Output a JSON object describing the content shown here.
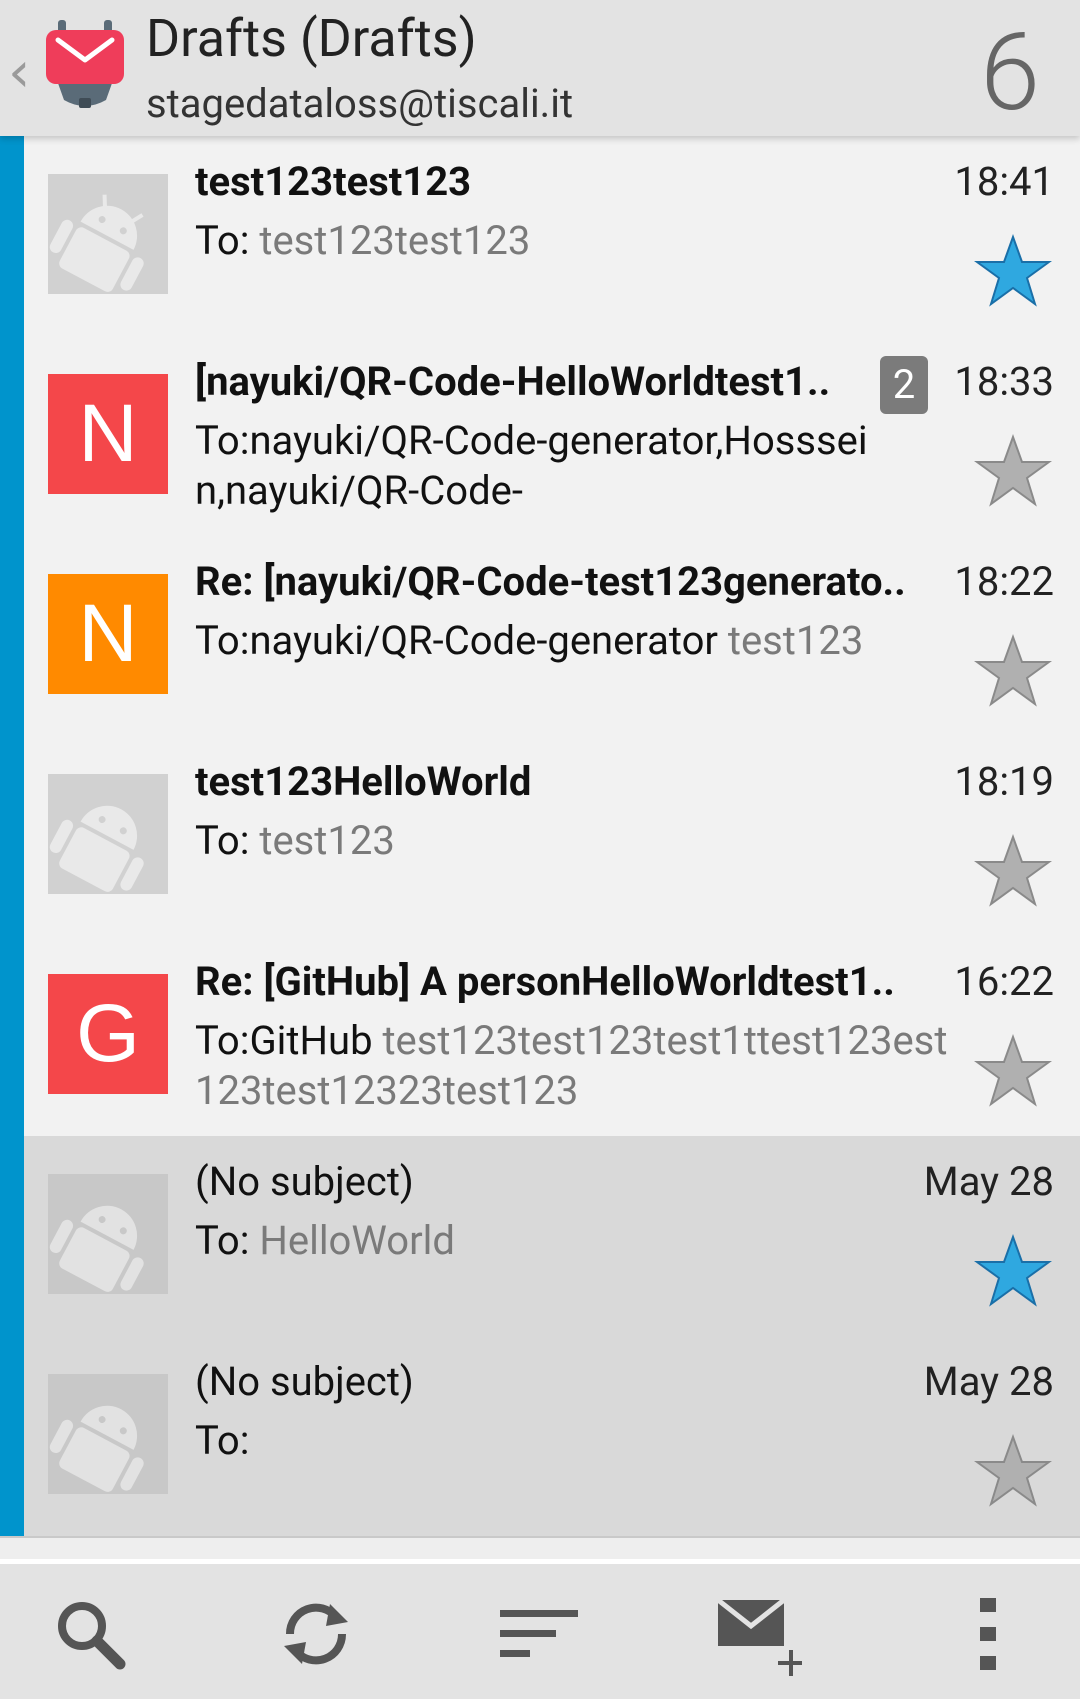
{
  "header": {
    "title": "Drafts (Drafts)",
    "account": "stagedataloss@tiscali.it",
    "count": "6",
    "logo_icon": "k9-mail-logo-icon",
    "back_icon": "chevron-left-icon"
  },
  "colors": {
    "accent": "#0094cc",
    "star_active": "#2fa8e0",
    "star_inactive": "#b0b0b0",
    "avatar_red": "#f4474a",
    "avatar_orange": "#ff8a00"
  },
  "messages": [
    {
      "subject": "test123test123",
      "to_label": "To: ",
      "to_name": "",
      "preview": "test123test123",
      "time": "18:41",
      "starred": true,
      "avatar": "placeholder"
    },
    {
      "subject": "[nayuki/QR-Code-HelloWorldtest1..",
      "to_label": "To:",
      "to_name": "nayuki/QR-Code-generator,Hosssein,nayuki/QR-Code-",
      "preview": "",
      "time": "18:33",
      "badge": "2",
      "starred": false,
      "avatar": "N"
    },
    {
      "subject": "Re: [nayuki/QR-Code-test123generato..",
      "to_label": "To:",
      "to_name": "nayuki/QR-Code-generator ",
      "preview": "test123",
      "time": "18:22",
      "starred": false,
      "avatar": "N"
    },
    {
      "subject": "test123HelloWorld",
      "to_label": "To: ",
      "to_name": "",
      "preview": "test123",
      "time": "18:19",
      "starred": false,
      "avatar": "placeholder"
    },
    {
      "subject": "Re: [GitHub] A personHelloWorldtest1..",
      "to_label": "To:",
      "to_name": "GitHub ",
      "preview": "test123test123test1ttest123est123test12323test123",
      "time": "16:22",
      "starred": false,
      "avatar": "G"
    },
    {
      "subject": "(No subject)",
      "to_label": "To: ",
      "to_name": "",
      "preview": "HelloWorld",
      "time": "May 28",
      "starred": true,
      "avatar": "placeholder"
    },
    {
      "subject": "(No subject)",
      "to_label": "To:",
      "to_name": "",
      "preview": "",
      "time": "May 28",
      "starred": false,
      "avatar": "placeholder"
    }
  ],
  "toolbar": {
    "search_icon": "search-icon",
    "refresh_icon": "refresh-icon",
    "sort_icon": "sort-icon",
    "compose_icon": "compose-icon",
    "overflow_icon": "overflow-menu-icon"
  }
}
